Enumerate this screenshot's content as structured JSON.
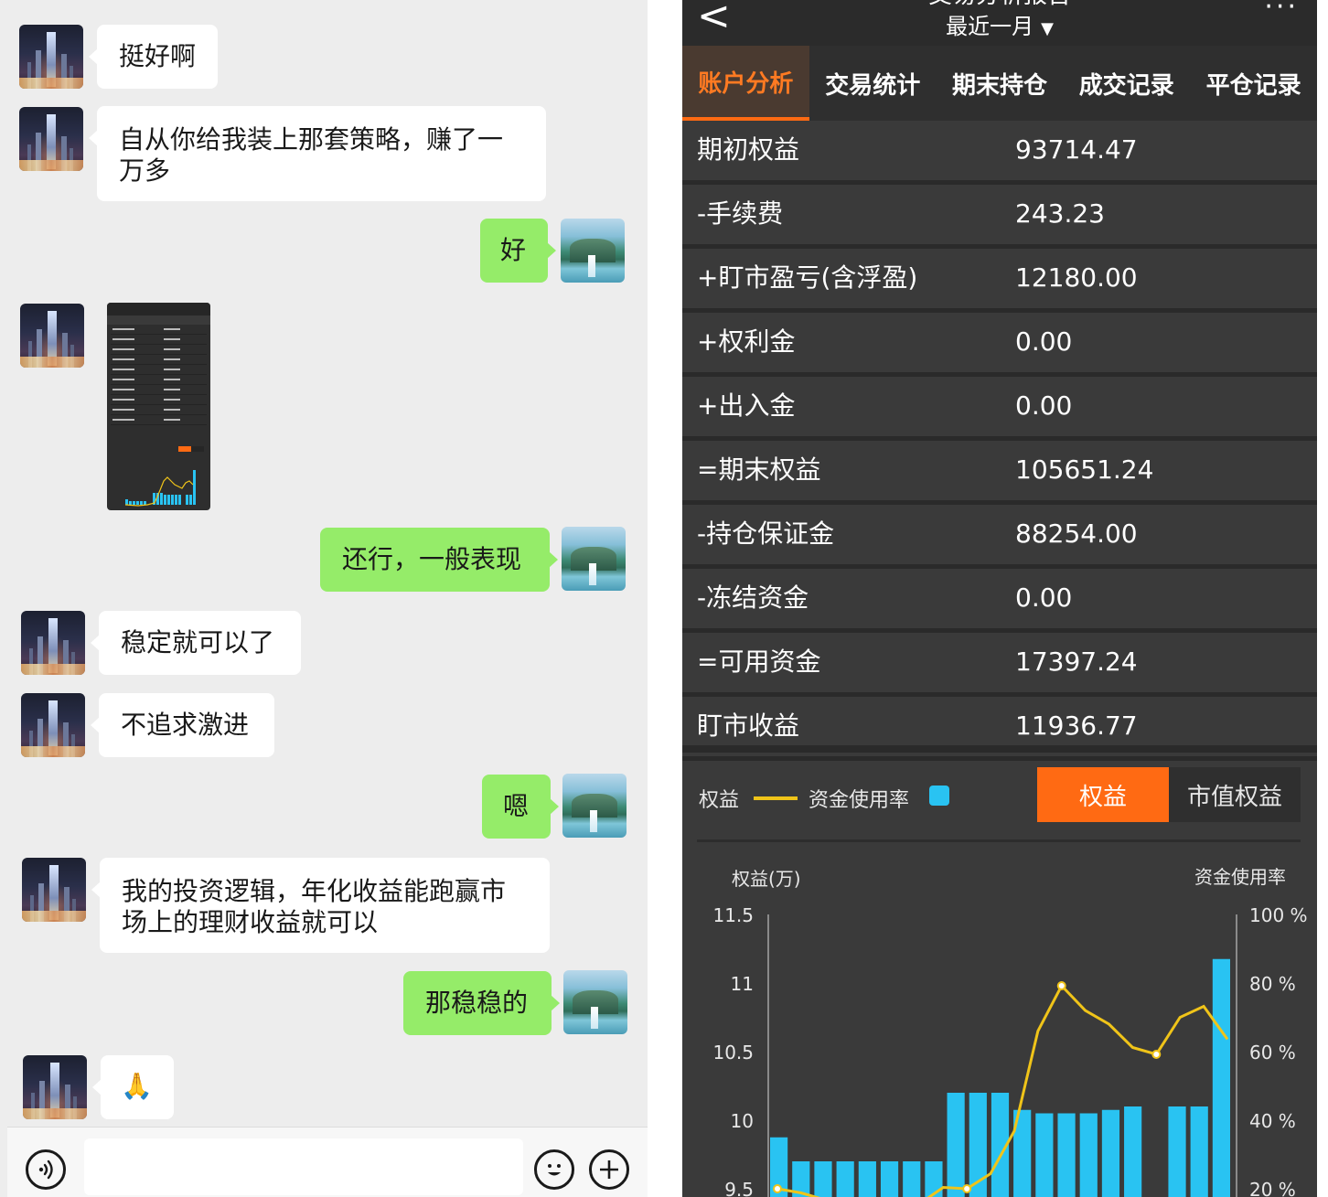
{
  "chat": {
    "messages": [
      {
        "side": "in",
        "text": "挺好啊"
      },
      {
        "side": "in",
        "text": "自从你给我装上那套策略，赚了一\n万多"
      },
      {
        "side": "out",
        "text": "好"
      },
      {
        "side": "in",
        "type": "image"
      },
      {
        "side": "out",
        "text": "还行，一般表现"
      },
      {
        "side": "in",
        "text": "稳定就可以了"
      },
      {
        "side": "in",
        "text": "不追求激进"
      },
      {
        "side": "out",
        "text": "嗯"
      },
      {
        "side": "in",
        "text": "我的投资逻辑，年化收益能跑赢市\n场上的理财收益就可以"
      },
      {
        "side": "out",
        "text": "那稳稳的"
      },
      {
        "side": "in",
        "text": "🙏"
      }
    ],
    "input": {
      "value": "",
      "placeholder": ""
    },
    "icons": {
      "voice": "voice-icon",
      "emoji": "emoji-icon",
      "plus": "plus-icon"
    }
  },
  "report": {
    "title": "交易分析报告",
    "period": "最近一月",
    "period_arrow": "▼",
    "back_glyph": "<",
    "more_glyph": "···",
    "tabs": [
      "账户分析",
      "交易统计",
      "期末持仓",
      "成交记录",
      "平仓记录"
    ],
    "active_tab": 0,
    "rows": [
      {
        "label": "期初权益",
        "value": "93714.47"
      },
      {
        "label": "-手续费",
        "value": "243.23"
      },
      {
        "label": "+盯市盈亏(含浮盈)",
        "value": "12180.00"
      },
      {
        "label": "+权利金",
        "value": "0.00"
      },
      {
        "label": "+出入金",
        "value": "0.00"
      },
      {
        "label": "=期末权益",
        "value": "105651.24"
      },
      {
        "label": "-持仓保证金",
        "value": "88254.00"
      },
      {
        "label": "-冻结资金",
        "value": "0.00"
      },
      {
        "label": "=可用资金",
        "value": "17397.24"
      },
      {
        "label": "盯市收益",
        "value": "11936.77"
      }
    ],
    "legend": {
      "equity": "权益",
      "usage": "资金使用率"
    },
    "toggle": {
      "equity": "权益",
      "market_equity": "市值权益",
      "active": "equity"
    },
    "colors": {
      "accent": "#ff6a13",
      "equity_line": "#f0c419",
      "usage_bar": "#29c3f2"
    }
  },
  "chart_data": {
    "type": "bar",
    "xlabel": "",
    "ylabel": "权益(万)",
    "ylabel_right": "资金使用率",
    "y_ticks": [
      "11.5",
      "11",
      "10.5",
      "10",
      "9.5"
    ],
    "y_right_ticks": [
      "100 %",
      "80 %",
      "60 %",
      "40 %",
      "20 %"
    ],
    "ylim": [
      9.5,
      11.5
    ],
    "ylim_right": [
      20,
      100
    ],
    "series": [
      {
        "name": "资金使用率",
        "type": "bar",
        "axis": "right",
        "values": [
          35,
          28,
          28,
          28,
          28,
          28,
          28,
          28,
          48,
          48,
          48,
          43,
          42,
          42,
          42,
          43,
          44,
          0,
          44,
          44,
          87
        ]
      },
      {
        "name": "权益",
        "type": "line",
        "axis": "left",
        "values": [
          9.5,
          9.47,
          9.42,
          9.4,
          9.38,
          9.36,
          9.39,
          9.51,
          9.5,
          9.61,
          9.92,
          10.65,
          10.98,
          10.8,
          10.7,
          10.53,
          10.48,
          10.75,
          10.83,
          10.59
        ]
      }
    ]
  }
}
